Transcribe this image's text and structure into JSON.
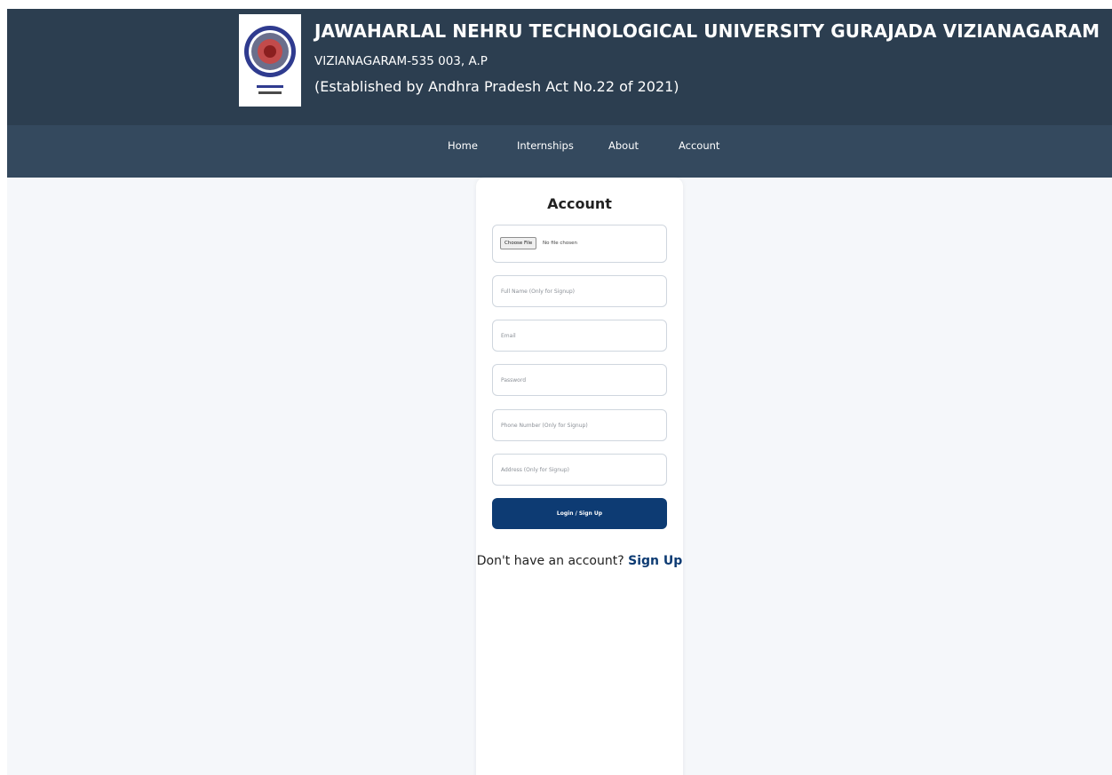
{
  "header": {
    "title": "JAWAHARLAL NEHRU TECHNOLOGICAL UNIVERSITY GURAJADA VIZIANAGARAM",
    "address": "VIZIANAGARAM-535 003, A.P",
    "established": "(Established by Andhra Pradesh Act No.22 of 2021)",
    "logo": {
      "icon": "university-seal-logo"
    }
  },
  "nav": {
    "items": [
      {
        "label": "Home"
      },
      {
        "label": "Internships"
      },
      {
        "label": "About"
      },
      {
        "label": "Account"
      }
    ]
  },
  "account_form": {
    "title": "Account",
    "file": {
      "button_label": "Choose File",
      "status": "No file chosen"
    },
    "full_name": {
      "placeholder": "Full Name (Only for Signup)",
      "value": ""
    },
    "email": {
      "placeholder": "Email",
      "value": ""
    },
    "password": {
      "placeholder": "Password",
      "value": ""
    },
    "phone": {
      "placeholder": "Phone Number (Only for Signup)",
      "value": ""
    },
    "address": {
      "placeholder": "Address (Only for Signup)",
      "value": ""
    },
    "submit_label": "Login / Sign Up",
    "switch_prompt": "Don't have an account?",
    "switch_link": "Sign Up"
  },
  "colors": {
    "header_bg": "#2c3e50",
    "nav_bg": "#34495e",
    "page_bg": "#f5f7fa",
    "primary_button": "#0d3b73",
    "link": "#0d3b73"
  }
}
